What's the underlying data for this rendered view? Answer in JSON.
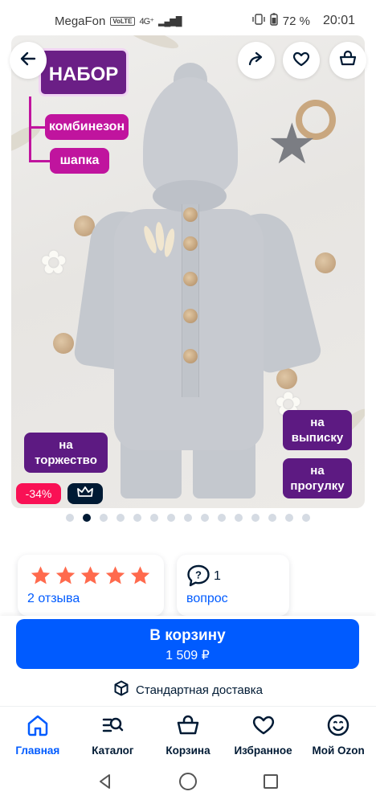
{
  "status_bar": {
    "carrier": "MegaFon",
    "volte": "VoLTE",
    "network": "4G⁺",
    "battery": "72 %",
    "time": "20:01"
  },
  "product_image": {
    "tags": {
      "set": "НАБОР",
      "overall": "комбинезон",
      "hat": "шапка",
      "celebration": "на торжество",
      "discharge": "на выписку",
      "walk": "на прогулку"
    },
    "discount_badge": "-34%",
    "premium_icon": "crown-icon",
    "slide_count": 15,
    "active_slide": 2
  },
  "top_actions": {
    "back_icon": "arrow-left-icon",
    "share_icon": "share-icon",
    "favorite_icon": "heart-icon",
    "cart_icon": "basket-icon"
  },
  "rating": {
    "stars": 5,
    "reviews": "2 отзыва"
  },
  "questions": {
    "count": "1",
    "label": "вопрос"
  },
  "cart_button": {
    "label": "В корзину",
    "price": "1 509 ₽"
  },
  "delivery": {
    "label": "Стандартная доставка"
  },
  "tab_bar": {
    "items": [
      {
        "label": "Главная",
        "icon": "home-icon",
        "active": true
      },
      {
        "label": "Каталог",
        "icon": "catalog-search-icon",
        "active": false
      },
      {
        "label": "Корзина",
        "icon": "basket-icon",
        "active": false
      },
      {
        "label": "Избранное",
        "icon": "heart-icon",
        "active": false
      },
      {
        "label": "Мой Ozon",
        "icon": "smiley-icon",
        "active": false
      }
    ]
  },
  "colors": {
    "accent": "#005bff",
    "discount": "#f91155",
    "star": "#ff6a4d",
    "tag_pink": "#c0149e",
    "tag_purple": "#5d1a82"
  }
}
